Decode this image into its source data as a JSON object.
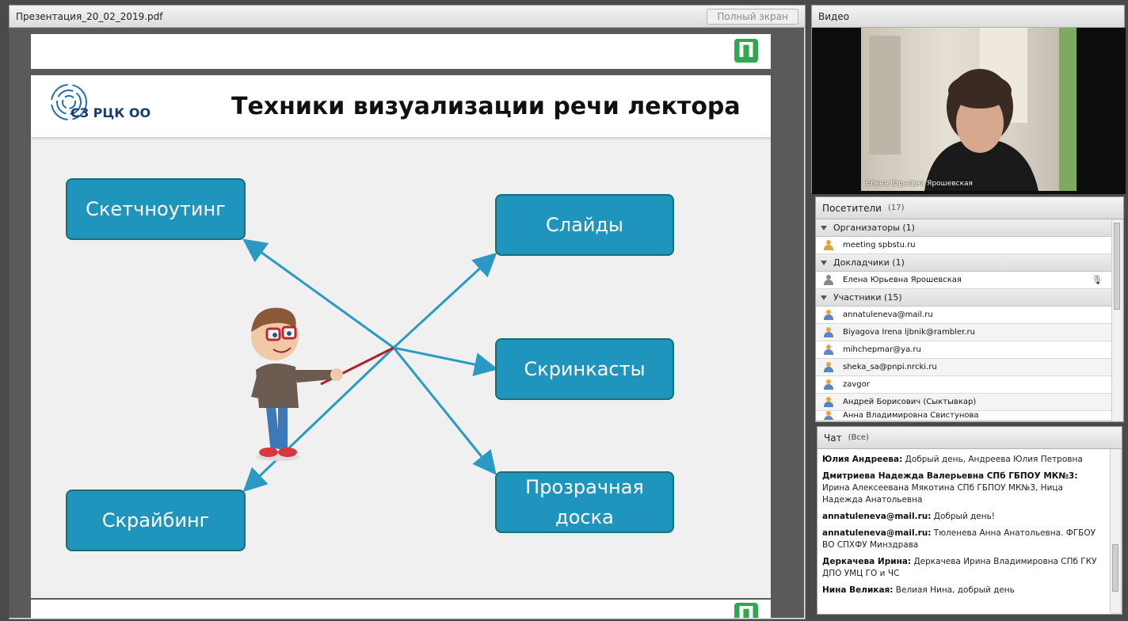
{
  "presentation": {
    "title": "Презентация_20_02_2019.pdf",
    "fullscreen_label": "Полный экран",
    "slide": {
      "logo_text": "СЗ РЦК ОО",
      "title": "Техники визуализации речи лектора",
      "boxes": {
        "sketchnoting": "Скетчноутинг",
        "slides": "Слайды",
        "screencasts": "Скринкасты",
        "scribing": "Скрайбинг",
        "whiteboard_line1": "Прозрачная",
        "whiteboard_line2": "доска"
      }
    },
    "politech_logo": "П"
  },
  "video": {
    "title": "Видео",
    "caption": "Елена Юрьевна Ярошевская"
  },
  "attendees": {
    "title": "Посетители",
    "count": "(17)",
    "groups": {
      "organizers": "Организаторы (1)",
      "presenters": "Докладчики (1)",
      "participants": "Участники (15)"
    },
    "organizers": [
      "meeting spbstu.ru"
    ],
    "presenters": [
      "Елена Юрьевна Ярошевская"
    ],
    "participants": [
      "annatuleneva@mail.ru",
      "Biyagova Irena ljbnik@rambler.ru",
      "mihchepmar@ya.ru",
      "sheka_sa@pnpi.nrcki.ru",
      "zavgor",
      "Андрей Борисович (Сыктывкар)",
      "Анна Владимировна Свистунова"
    ]
  },
  "chat": {
    "title": "Чат",
    "scope": "(Все)",
    "messages": [
      {
        "author": "Юлия Андреева:",
        "text": " Добрый день, Андреева Юлия Петровна"
      },
      {
        "author": "Дмитриева Надежда Валерьевна СПб ГБПОУ МК№3:",
        "text": " Ирина Алексеевана Мякотина СПб ГБПОУ МК№3, Ница Надежда Анатольевна"
      },
      {
        "author": "annatuleneva@mail.ru:",
        "text": " Добрый день!"
      },
      {
        "author": "annatuleneva@mail.ru:",
        "text": " Тюленева Анна Анатольевна. ФГБОУ ВО СПХФУ Минздрава"
      },
      {
        "author": "Деркачева Ирина:",
        "text": " Деркачева Ирина Владимировна СПб ГКУ ДПО УМЦ ГО и ЧС"
      },
      {
        "author": "Нина Великая:",
        "text": " Велиая Нина, добрый день"
      }
    ]
  }
}
